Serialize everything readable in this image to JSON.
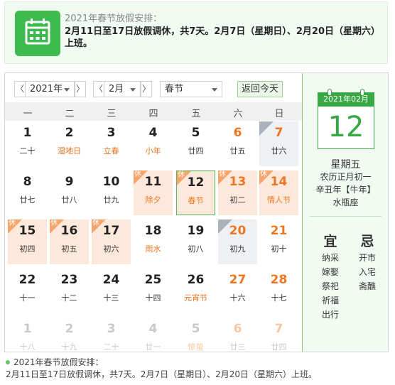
{
  "notice": {
    "title": "2021年春节放假安排：",
    "body": "2月11日至17日放假调休，共7天。2月7日（星期日）、2月20日（星期六）上班。"
  },
  "toolbar": {
    "prev": "〈",
    "next": "〉",
    "year": "2021年",
    "month": "2月",
    "festival": "春节",
    "today_button": "返回今天"
  },
  "weekdays": [
    "一",
    "二",
    "三",
    "四",
    "五",
    "六",
    "日"
  ],
  "tags": {
    "holiday": "休",
    "workday": "班"
  },
  "days": [
    {
      "n": "1",
      "l": "二十",
      "we": false,
      "fe": false,
      "tag": "",
      "cur": true
    },
    {
      "n": "2",
      "l": "湿地日",
      "we": false,
      "fe": true,
      "tag": "",
      "cur": true
    },
    {
      "n": "3",
      "l": "立春",
      "we": false,
      "fe": true,
      "tag": "",
      "cur": true
    },
    {
      "n": "4",
      "l": "小年",
      "we": false,
      "fe": true,
      "tag": "",
      "cur": true
    },
    {
      "n": "5",
      "l": "廿四",
      "we": false,
      "fe": false,
      "tag": "",
      "cur": true
    },
    {
      "n": "6",
      "l": "廿五",
      "we": true,
      "fe": false,
      "tag": "",
      "cur": true
    },
    {
      "n": "7",
      "l": "廿六",
      "we": true,
      "fe": false,
      "tag": "work",
      "cur": true
    },
    {
      "n": "8",
      "l": "廿七",
      "we": false,
      "fe": false,
      "tag": "",
      "cur": true
    },
    {
      "n": "9",
      "l": "廿八",
      "we": false,
      "fe": false,
      "tag": "",
      "cur": true
    },
    {
      "n": "10",
      "l": "廿九",
      "we": false,
      "fe": false,
      "tag": "",
      "cur": true
    },
    {
      "n": "11",
      "l": "除夕",
      "we": false,
      "fe": true,
      "tag": "holiday",
      "cur": true
    },
    {
      "n": "12",
      "l": "春节",
      "we": false,
      "fe": true,
      "tag": "holiday",
      "cur": true,
      "sel": true
    },
    {
      "n": "13",
      "l": "初二",
      "we": true,
      "fe": false,
      "tag": "holiday",
      "cur": true
    },
    {
      "n": "14",
      "l": "情人节",
      "we": true,
      "fe": true,
      "tag": "holiday",
      "cur": true
    },
    {
      "n": "15",
      "l": "初四",
      "we": false,
      "fe": false,
      "tag": "holiday",
      "cur": true
    },
    {
      "n": "16",
      "l": "初五",
      "we": false,
      "fe": false,
      "tag": "holiday",
      "cur": true
    },
    {
      "n": "17",
      "l": "初六",
      "we": false,
      "fe": false,
      "tag": "holiday",
      "cur": true
    },
    {
      "n": "18",
      "l": "雨水",
      "we": false,
      "fe": true,
      "tag": "",
      "cur": true
    },
    {
      "n": "19",
      "l": "初八",
      "we": false,
      "fe": false,
      "tag": "",
      "cur": true
    },
    {
      "n": "20",
      "l": "初九",
      "we": true,
      "fe": false,
      "tag": "work",
      "cur": true
    },
    {
      "n": "21",
      "l": "初十",
      "we": true,
      "fe": false,
      "tag": "",
      "cur": true
    },
    {
      "n": "22",
      "l": "十一",
      "we": false,
      "fe": false,
      "tag": "",
      "cur": true
    },
    {
      "n": "23",
      "l": "十二",
      "we": false,
      "fe": false,
      "tag": "",
      "cur": true
    },
    {
      "n": "24",
      "l": "十三",
      "we": false,
      "fe": false,
      "tag": "",
      "cur": true
    },
    {
      "n": "25",
      "l": "十四",
      "we": false,
      "fe": false,
      "tag": "",
      "cur": true
    },
    {
      "n": "26",
      "l": "元宵节",
      "we": false,
      "fe": true,
      "tag": "",
      "cur": true
    },
    {
      "n": "27",
      "l": "十六",
      "we": true,
      "fe": false,
      "tag": "",
      "cur": true
    },
    {
      "n": "28",
      "l": "十七",
      "we": true,
      "fe": false,
      "tag": "",
      "cur": true
    },
    {
      "n": "1",
      "l": "十八",
      "we": false,
      "fe": false,
      "tag": "",
      "cur": false
    },
    {
      "n": "2",
      "l": "十九",
      "we": false,
      "fe": false,
      "tag": "",
      "cur": false
    },
    {
      "n": "3",
      "l": "二十",
      "we": false,
      "fe": false,
      "tag": "",
      "cur": false
    },
    {
      "n": "4",
      "l": "廿一",
      "we": false,
      "fe": false,
      "tag": "",
      "cur": false
    },
    {
      "n": "5",
      "l": "惊蛰",
      "we": false,
      "fe": true,
      "tag": "",
      "cur": false
    },
    {
      "n": "6",
      "l": "廿三",
      "we": true,
      "fe": false,
      "tag": "",
      "cur": false
    },
    {
      "n": "7",
      "l": "廿四",
      "we": true,
      "fe": false,
      "tag": "",
      "cur": false
    }
  ],
  "panel": {
    "month_header": "2021年02月",
    "day": "12",
    "weekday": "星期五",
    "lunar": "农历正月初一",
    "ganzhi": "辛丑年【牛年】",
    "zodiac": "水瓶座",
    "yi_label": "宜",
    "ji_label": "忌",
    "yi": [
      "纳采",
      "嫁娶",
      "祭祀",
      "祈福",
      "出行"
    ],
    "ji": [
      "开市",
      "入宅",
      "斋醮"
    ]
  },
  "footer": {
    "title": "2021年春节放假安排：",
    "body": "2月11日至17日放假调休，共7天。2月7日（星期日）、2月20日（星期六）上班。"
  },
  "colors": {
    "accent": "#37a843",
    "holiday_bg": "#fde9dc",
    "weekend_text": "#f07521"
  }
}
